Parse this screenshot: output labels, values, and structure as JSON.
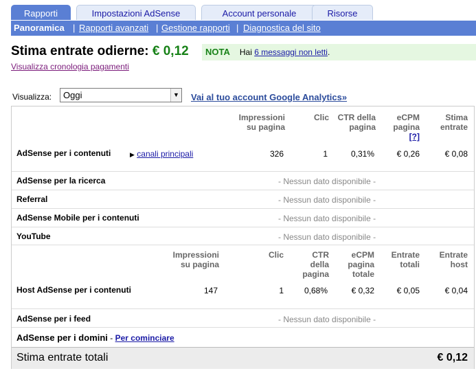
{
  "tabs": [
    {
      "label": "Rapporti"
    },
    {
      "label": "Impostazioni AdSense"
    },
    {
      "label": "Account personale"
    },
    {
      "label": "Risorse"
    }
  ],
  "subnav": {
    "current": "Panoramica",
    "items": [
      "Rapporti avanzati",
      "Gestione rapporti",
      "Diagnostica del sito"
    ]
  },
  "header": {
    "title": "Stima entrate odierne:",
    "amount": "€ 0,12",
    "history_link": "Visualizza cronologia pagamenti"
  },
  "note": {
    "label": "NOTA",
    "text_before": "Hai",
    "link": "6 messaggi non letti",
    "text_after": "."
  },
  "view": {
    "label": "Visualizza:",
    "selected": "Oggi",
    "ga_link": "Vai al tuo account Google Analytics»"
  },
  "content_header": {
    "impr": [
      "Impressioni",
      "su pagina"
    ],
    "clicks": "Clic",
    "ctr": [
      "CTR della",
      "pagina"
    ],
    "ecpm": [
      "eCPM",
      "pagina",
      "[?]"
    ],
    "stima": [
      "Stima",
      "entrate"
    ]
  },
  "content_row": {
    "label": "AdSense per i contenuti",
    "channels_link": "canali principali",
    "impr": "326",
    "clicks": "1",
    "ctr": "0,31%",
    "ecpm": "€ 0,26",
    "stima": "€ 0,08"
  },
  "nodata_text": "- Nessun dato disponibile -",
  "nodata_rows": [
    "AdSense per la ricerca",
    "Referral",
    "AdSense Mobile per i contenuti",
    "YouTube"
  ],
  "host_header": {
    "impr": [
      "Impressioni",
      "su pagina"
    ],
    "clicks": "Clic",
    "ctr": [
      "CTR",
      "della",
      "pagina"
    ],
    "ecpm": [
      "eCPM",
      "pagina",
      "totale"
    ],
    "entrate": [
      "Entrate",
      "totali"
    ],
    "host": [
      "Entrate",
      "host"
    ]
  },
  "host_row": {
    "label": "Host AdSense per i contenuti",
    "impr": "147",
    "clicks": "1",
    "ctr": "0,68%",
    "ecpm": "€ 0,32",
    "entrate": "€ 0,05",
    "host": "€ 0,04"
  },
  "feed_row": {
    "label": "AdSense per i feed"
  },
  "domains_row": {
    "label": "AdSense per i domini",
    "sep": "-",
    "link": "Per cominciare"
  },
  "total": {
    "label": "Stima entrate totali",
    "amount": "€ 0,12"
  }
}
